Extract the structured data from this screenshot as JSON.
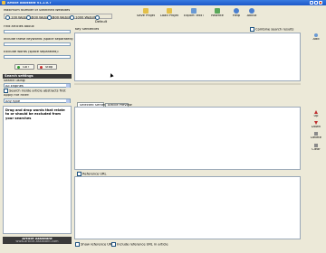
{
  "app": {
    "title": "Article Assistant V1.1.0.7"
  },
  "max_results": {
    "label": "Maximum Number of Searched Websites",
    "options": [
      "100 Websites",
      "200 Websites",
      "300 Websites",
      "1000 Websites",
      "Default"
    ]
  },
  "toolbar": {
    "save_project": "Save Project",
    "load_project": "Load Project",
    "export_text": "Export Text File",
    "rewrite": "Rewrite",
    "help": "Help",
    "about": "About"
  },
  "left": {
    "find_articles_label": "Find articles about:",
    "include_label": "Include these keywords (space separated):",
    "exclude_label": "Exclude words (space separated):",
    "go_label": "Go !",
    "stop_label": "Stop",
    "search_settings": "Search settings",
    "search_using_label": "Search using:",
    "search_using_value": "All Engines",
    "search_filter_label": "Search inside article abstracts first",
    "file_filter_label": "Apply File Filter:",
    "file_filter_value": "Any type",
    "hint_text": "Drag and drop words that relate to or should be excluded from your searches",
    "footer_title": "Article Assistant",
    "footer_subtitle": "www.article-assistant.com"
  },
  "right": {
    "key_sentences_label": "Key Sentences",
    "combine_label": "Combine search results",
    "tabs": [
      "Selected Sentences",
      "Article Preview"
    ],
    "reference_label": "Reference URL",
    "show_reference_label": "Show reference URL",
    "include_reference_label": "Include reference URL in article"
  },
  "sidebar": {
    "add": "Add",
    "up": "Up",
    "down": "Down",
    "delete": "Delete",
    "clear": "Clear"
  }
}
